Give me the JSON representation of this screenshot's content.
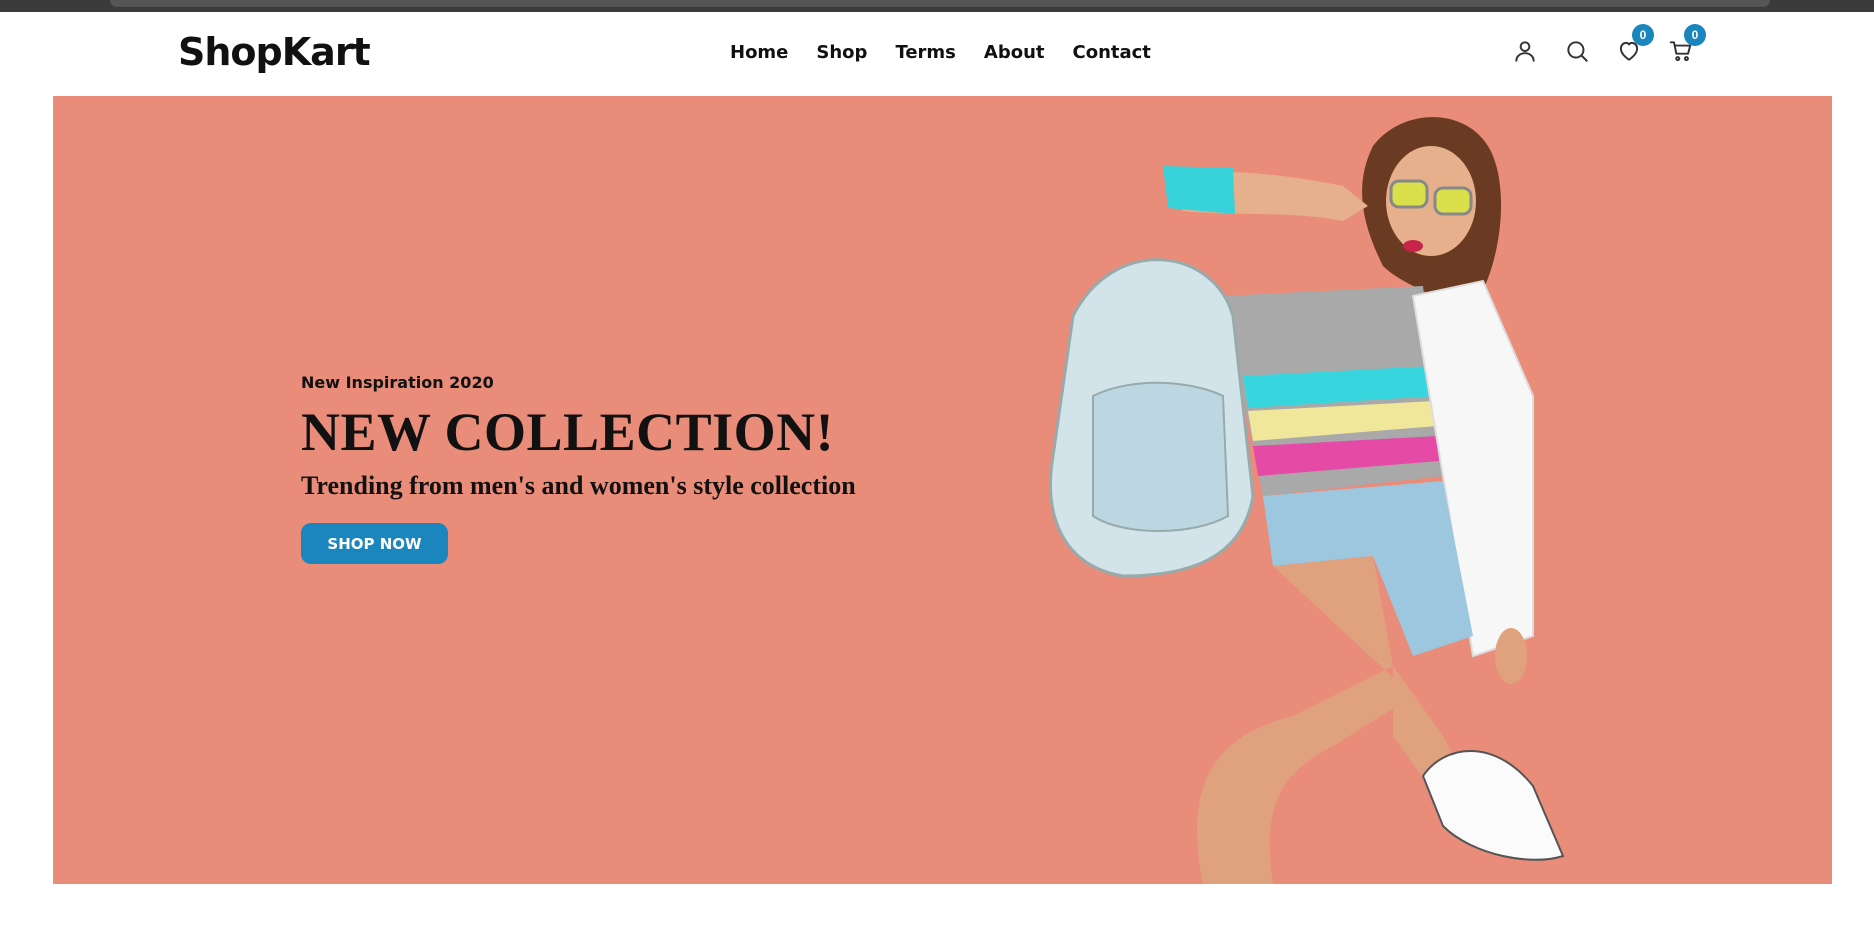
{
  "brand": {
    "logo": "ShopKart"
  },
  "nav": {
    "items": [
      {
        "label": "Home"
      },
      {
        "label": "Shop"
      },
      {
        "label": "Terms"
      },
      {
        "label": "About"
      },
      {
        "label": "Contact"
      }
    ]
  },
  "header_icons": {
    "user": "user-icon",
    "search": "search-icon",
    "wishlist": {
      "icon": "heart-icon",
      "count": "0"
    },
    "cart": {
      "icon": "cart-icon",
      "count": "0"
    }
  },
  "hero": {
    "subtitle": "New Inspiration 2020",
    "title": "NEW COLLECTION!",
    "text": "Trending from men's and women's style collection",
    "button_label": "SHOP NOW",
    "background_color": "#e98c7a",
    "image": "fashion-model-image"
  },
  "colors": {
    "accent": "#1a86bd",
    "hero_bg": "#e98c7a",
    "text": "#111111"
  }
}
